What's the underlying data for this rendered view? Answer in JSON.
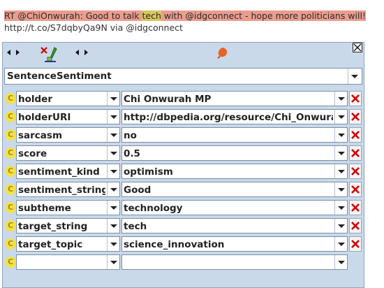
{
  "document": {
    "line1_before": "RT @ChiOnwurah: Good to talk ",
    "line1_highlight": "tech",
    "line1_after": " with @idgconnect - hope more politicians will!",
    "line2": "http://t.co/S7dqbyQa9N via @idgconnect"
  },
  "annotation_editor": {
    "type": "SentenceSentiment",
    "features": [
      {
        "name": "holder",
        "value": "Chi Onwurah MP"
      },
      {
        "name": "holderURI",
        "value": "http://dbpedia.org/resource/Chi_Onwurah"
      },
      {
        "name": "sarcasm",
        "value": "no"
      },
      {
        "name": "score",
        "value": "0.5"
      },
      {
        "name": "sentiment_kind",
        "value": "optimism"
      },
      {
        "name": "sentiment_string",
        "value": "Good"
      },
      {
        "name": "subtheme",
        "value": "technology"
      },
      {
        "name": "target_string",
        "value": "tech"
      },
      {
        "name": "target_topic",
        "value": "science_innovation"
      },
      {
        "name": "",
        "value": ""
      }
    ],
    "badge_letter": "C"
  },
  "colors": {
    "annotation_highlight": "#e99d8e",
    "tech_highlight": "#d7c75e",
    "panel_background": "#c9d9ea",
    "delete_red": "#d40000",
    "badge_yellow": "#f2e24a"
  },
  "icons": [
    "arrow-left-icon",
    "arrow-right-icon",
    "remove-annotation-icon",
    "color-icon",
    "close-icon",
    "dropdown-icon",
    "delete-feature-icon"
  ]
}
